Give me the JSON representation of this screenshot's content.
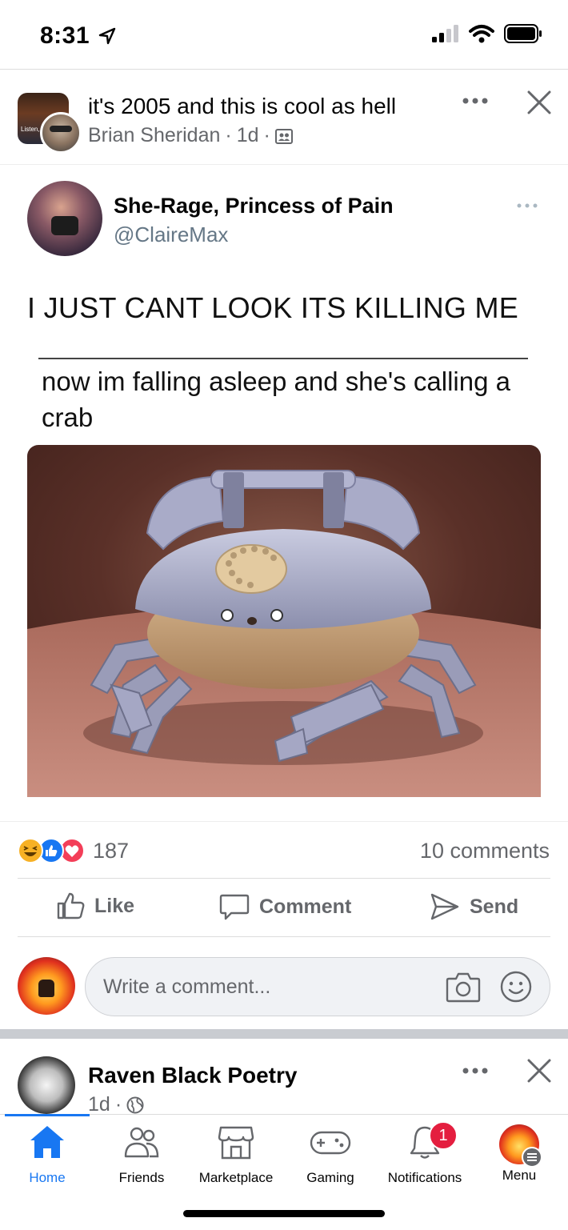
{
  "status_bar": {
    "time": "8:31"
  },
  "post": {
    "title": "it's 2005 and this is cool as hell",
    "author": "Brian Sheridan",
    "time": "1d",
    "group_thumb_text": "Listen, things"
  },
  "tweet": {
    "name": "She-Rage, Princess of Pain",
    "handle": "@ClaireMax",
    "text": "I JUST CANT LOOK ITS KILLING ME",
    "inner_text": "now im falling asleep and she's calling a crab"
  },
  "reactions": {
    "count": "187",
    "comments": "10 comments"
  },
  "actions": {
    "like": "Like",
    "comment": "Comment",
    "send": "Send"
  },
  "comment_input": {
    "placeholder": "Write a comment..."
  },
  "next_post": {
    "author": "Raven Black Poetry",
    "time": "1d"
  },
  "bottom_nav": {
    "home": "Home",
    "friends": "Friends",
    "marketplace": "Marketplace",
    "gaming": "Gaming",
    "notifications": "Notifications",
    "notifications_badge": "1",
    "menu": "Menu"
  },
  "colors": {
    "accent": "#1877f2",
    "badge": "#e41e3f",
    "muted": "#65676b"
  }
}
